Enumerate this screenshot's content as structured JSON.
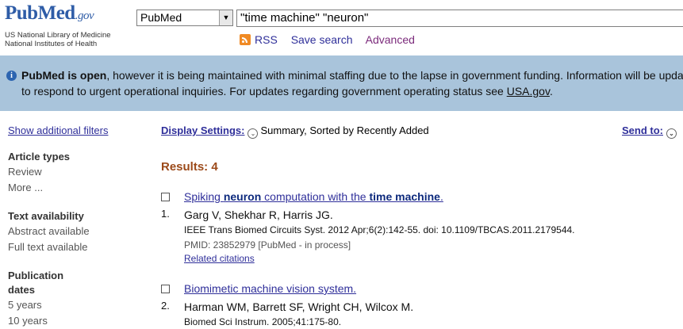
{
  "header": {
    "logo": {
      "brand_pub": "Pub",
      "brand_med": "Med",
      "brand_gov": ".gov",
      "org_line1": "US National Library of Medicine",
      "org_line2": "National Institutes of Health"
    },
    "database_select": "PubMed",
    "search_query": "\"time machine\" \"neuron\"",
    "links": {
      "rss": "RSS",
      "save_search": "Save search",
      "advanced": "Advanced"
    }
  },
  "banner": {
    "bold_text": "PubMed is open",
    "text1": ", however it is being maintained with minimal staffing due to the lapse in government funding. Information will be updated to",
    "text2": "to respond to urgent operational inquiries. For updates regarding government operating status see ",
    "link": "USA.gov",
    "text3": "."
  },
  "sidebar": {
    "show_filters": "Show additional filters",
    "sections": [
      {
        "title": "Article types",
        "options": [
          "Review",
          "More ..."
        ]
      },
      {
        "title": "Text availability",
        "options": [
          "Abstract available",
          "Full text available"
        ]
      },
      {
        "title": "Publication dates",
        "options": [
          "5 years",
          "10 years"
        ]
      }
    ]
  },
  "toolbar": {
    "display_settings_label": "Display Settings:",
    "display_settings_value": "Summary, Sorted by Recently Added",
    "send_to": "Send to:"
  },
  "results": {
    "count_label": "Results: 4",
    "items": [
      {
        "number": "1.",
        "title_parts": [
          {
            "text": "Spiking ",
            "bold": false
          },
          {
            "text": "neuron",
            "bold": true
          },
          {
            "text": " computation with the ",
            "bold": false
          },
          {
            "text": "time machine",
            "bold": true
          },
          {
            "text": ".",
            "bold": false
          }
        ],
        "authors": "Garg V, Shekhar R, Harris JG.",
        "citation": "IEEE Trans Biomed Circuits Syst. 2012 Apr;6(2):142-55. doi: 10.1109/TBCAS.2011.2179544.",
        "pmid": "PMID: 23852979 [PubMed - in process]",
        "related": "Related citations"
      },
      {
        "number": "2.",
        "title_parts": [
          {
            "text": "Biomimetic machine vision system.",
            "bold": false
          }
        ],
        "authors": "Harman WM, Barrett SF, Wright CH, Wilcox M.",
        "citation": "Biomed Sci Instrum. 2005;41:175-80."
      }
    ]
  },
  "colors": {
    "banner_bg": "#a9c4db",
    "link": "#2f2f9a",
    "results_count": "#9c4a1a",
    "advanced_link": "#7b2a7b"
  },
  "icons": {
    "rss": "rss-icon",
    "info": "info-icon",
    "dropdown": "chevron-down-icon"
  }
}
